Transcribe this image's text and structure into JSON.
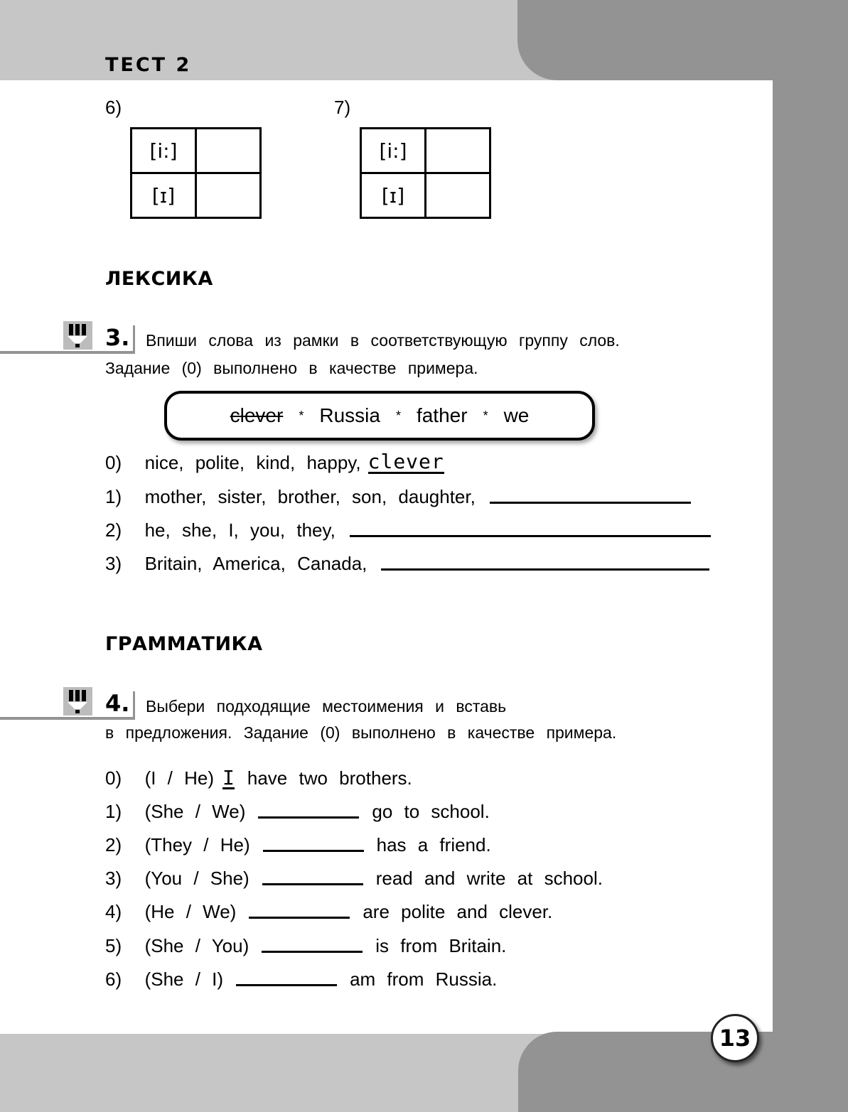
{
  "header": {
    "title": "ТЕСТ 2"
  },
  "phonetics": {
    "items": [
      {
        "number": "6)",
        "rows": [
          {
            "sound": "[i:]",
            "answer": ""
          },
          {
            "sound": "[ɪ]",
            "answer": ""
          }
        ]
      },
      {
        "number": "7)",
        "rows": [
          {
            "sound": "[i:]",
            "answer": ""
          },
          {
            "sound": "[ɪ]",
            "answer": ""
          }
        ]
      }
    ]
  },
  "lexis": {
    "section_title": "ЛЕКСИКА",
    "task": {
      "number": "3.",
      "instruction_line1": "Впиши слова из рамки в соответствующую группу слов.",
      "instruction_line2": "Задание (0) выполнено в качестве примера.",
      "word_box": {
        "words": [
          "clever",
          "Russia",
          "father",
          "we"
        ],
        "struck_word": "clever",
        "separator": "*"
      },
      "exercises": [
        {
          "number": "0)",
          "text": "nice, polite, kind, happy,",
          "answer": "clever"
        },
        {
          "number": "1)",
          "text": "mother, sister, brother, son, daughter,",
          "answer": ""
        },
        {
          "number": "2)",
          "text": "he, she, I, you, they,",
          "answer": ""
        },
        {
          "number": "3)",
          "text": "Britain, America, Canada,",
          "answer": ""
        }
      ]
    }
  },
  "grammar": {
    "section_title": "ГРАММАТИКА",
    "task": {
      "number": "4.",
      "instruction_line1": "Выбери подходящие местоимения и вставь",
      "instruction_line2": "в предложения. Задание (0) выполнено в качестве примера.",
      "exercises": [
        {
          "number": "0)",
          "options": "(I / He)",
          "answer": "I",
          "rest": "have two brothers."
        },
        {
          "number": "1)",
          "options": "(She / We)",
          "answer": "",
          "rest": "go to school."
        },
        {
          "number": "2)",
          "options": "(They / He)",
          "answer": "",
          "rest": "has a friend."
        },
        {
          "number": "3)",
          "options": "(You / She)",
          "answer": "",
          "rest": "read and write at school."
        },
        {
          "number": "4)",
          "options": "(He / We)",
          "answer": "",
          "rest": "are polite and clever."
        },
        {
          "number": "5)",
          "options": "(She / You)",
          "answer": "",
          "rest": "is from Britain."
        },
        {
          "number": "6)",
          "options": "(She / I)",
          "answer": "",
          "rest": "am from Russia."
        }
      ]
    }
  },
  "footer": {
    "page_number": "13"
  },
  "colors": {
    "band_light": "#c6c6c6",
    "band_dark": "#939393",
    "text": "#000000"
  }
}
